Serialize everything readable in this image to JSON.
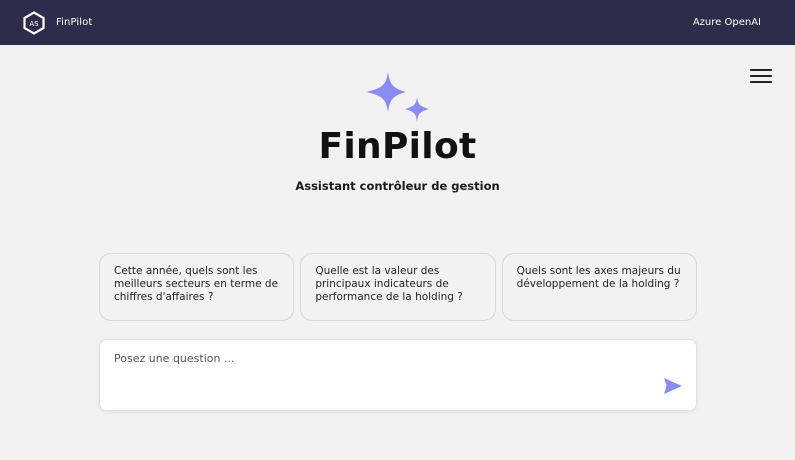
{
  "header": {
    "logo_icon": "hexagon-logo-icon",
    "logo_text": "AS",
    "brand": "FinPilot",
    "provider": "Azure OpenAI",
    "background": "#2b2d4a"
  },
  "menu": {
    "icon": "hamburger-menu-icon"
  },
  "hero": {
    "icon": "sparkles-icon",
    "accent": "#8b8cf2",
    "title": "FinPilot",
    "subtitle": "Assistant contrôleur de gestion"
  },
  "suggestions": [
    {
      "text": "Cette année, quels sont les meilleurs secteurs en terme de chiffres d'affaires ?"
    },
    {
      "text": "Quelle est la valeur des principaux indicateurs de performance de la holding ?"
    },
    {
      "text": "Quels sont les axes majeurs du développement de la holding ?"
    }
  ],
  "composer": {
    "placeholder": "Posez une question ...",
    "value": "",
    "send_icon": "send-icon"
  }
}
